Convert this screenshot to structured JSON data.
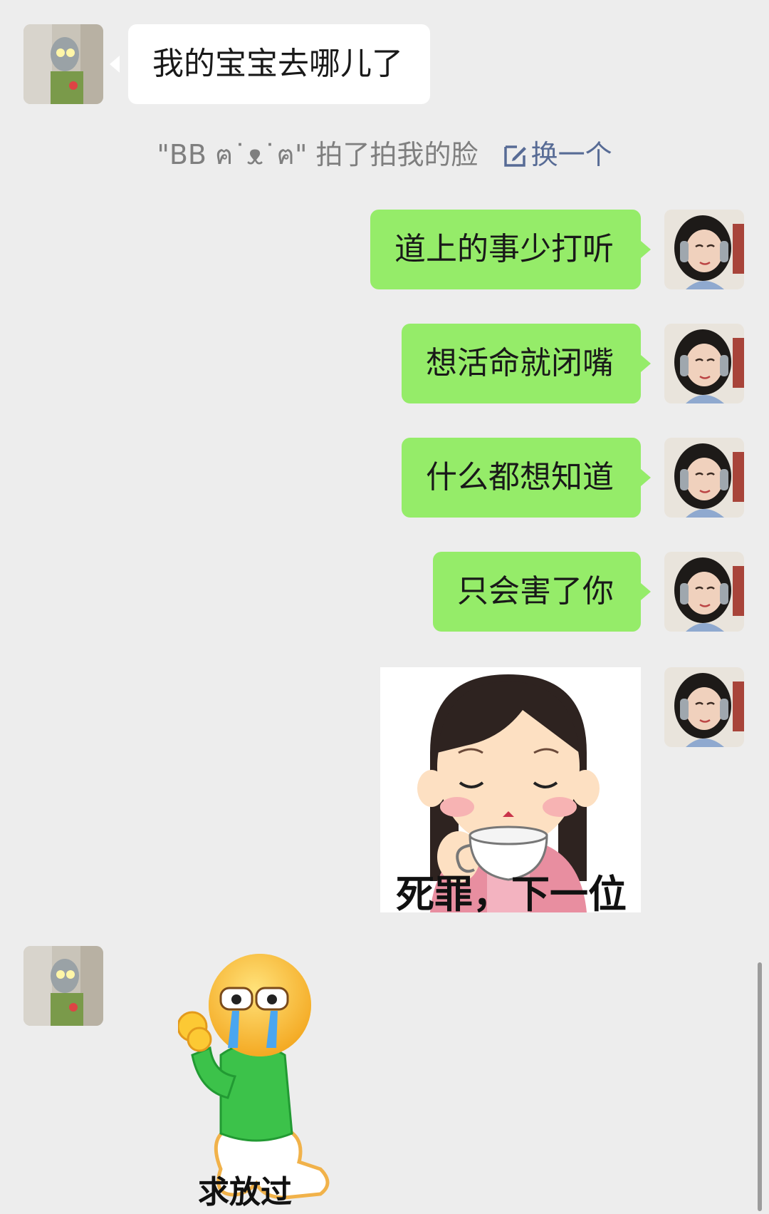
{
  "messages": [
    {
      "side": "in",
      "text": "我的宝宝去哪儿了"
    },
    {
      "side": "out",
      "text": "道上的事少打听"
    },
    {
      "side": "out",
      "text": "想活命就闭嘴"
    },
    {
      "side": "out",
      "text": "什么都想知道"
    },
    {
      "side": "out",
      "text": "只会害了你"
    }
  ],
  "system_notice": {
    "text": "\"BB ฅ˙ᴥ˙ฅ\" 拍了拍我的脸",
    "action_label": "换一个"
  },
  "stickers": {
    "outgoing_caption": "死罪，下一位",
    "incoming_caption": "求放过"
  },
  "colors": {
    "background": "#ededed",
    "bubble_out": "#95ec69",
    "bubble_in": "#ffffff",
    "link": "#576b95"
  }
}
